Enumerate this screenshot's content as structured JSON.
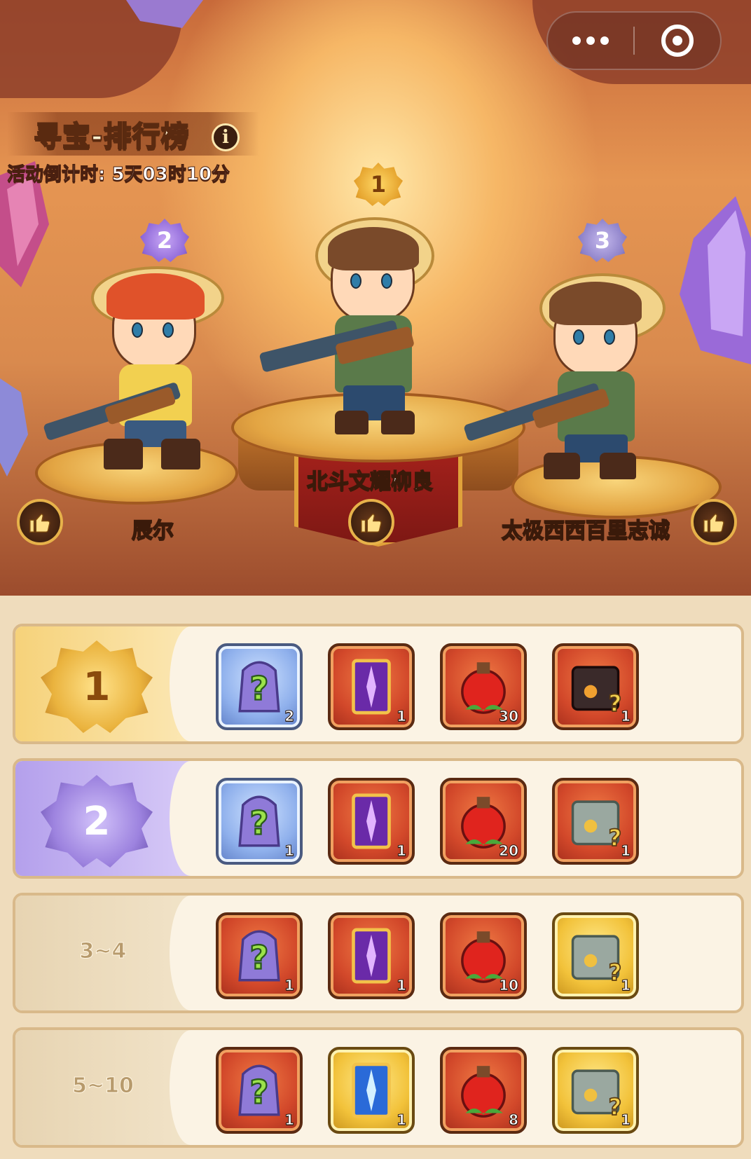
{
  "header": {
    "title": "寻宝-排行榜",
    "info_icon": "i",
    "countdown": "活动倒计时: 5天03时10分",
    "menu_icons": [
      "more-dots-icon",
      "close-target-icon"
    ]
  },
  "podium": [
    {
      "rank": "1",
      "name": "北斗文耀柳良",
      "medal_color": "#e5a22c"
    },
    {
      "rank": "2",
      "name": "辰尔",
      "medal_color": "#8f68d8"
    },
    {
      "rank": "3",
      "name": "太极西西百里志诚",
      "medal_color": "#8c80c8"
    }
  ],
  "rewards": [
    {
      "rank_label": "1",
      "items": [
        {
          "icon": "mystery-armor-icon",
          "count": "2"
        },
        {
          "icon": "purple-card-icon",
          "count": "1"
        },
        {
          "icon": "red-potion-icon",
          "count": "30"
        },
        {
          "icon": "dark-treasure-chest-icon",
          "count": "1"
        }
      ]
    },
    {
      "rank_label": "2",
      "items": [
        {
          "icon": "mystery-armor-icon",
          "count": "1"
        },
        {
          "icon": "purple-card-icon",
          "count": "1"
        },
        {
          "icon": "red-potion-icon",
          "count": "20"
        },
        {
          "icon": "stone-treasure-chest-icon",
          "count": "1"
        }
      ]
    },
    {
      "rank_label": "3~4",
      "items": [
        {
          "icon": "mystery-armor-icon",
          "count": "1"
        },
        {
          "icon": "purple-card-icon",
          "count": "1"
        },
        {
          "icon": "red-potion-icon",
          "count": "10"
        },
        {
          "icon": "stone-treasure-chest-icon",
          "count": "1"
        }
      ]
    },
    {
      "rank_label": "5~10",
      "items": [
        {
          "icon": "mystery-armor-icon",
          "count": "1"
        },
        {
          "icon": "blue-card-icon",
          "count": "1"
        },
        {
          "icon": "red-potion-icon",
          "count": "8"
        },
        {
          "icon": "stone-treasure-chest-icon",
          "count": "1"
        }
      ]
    }
  ]
}
